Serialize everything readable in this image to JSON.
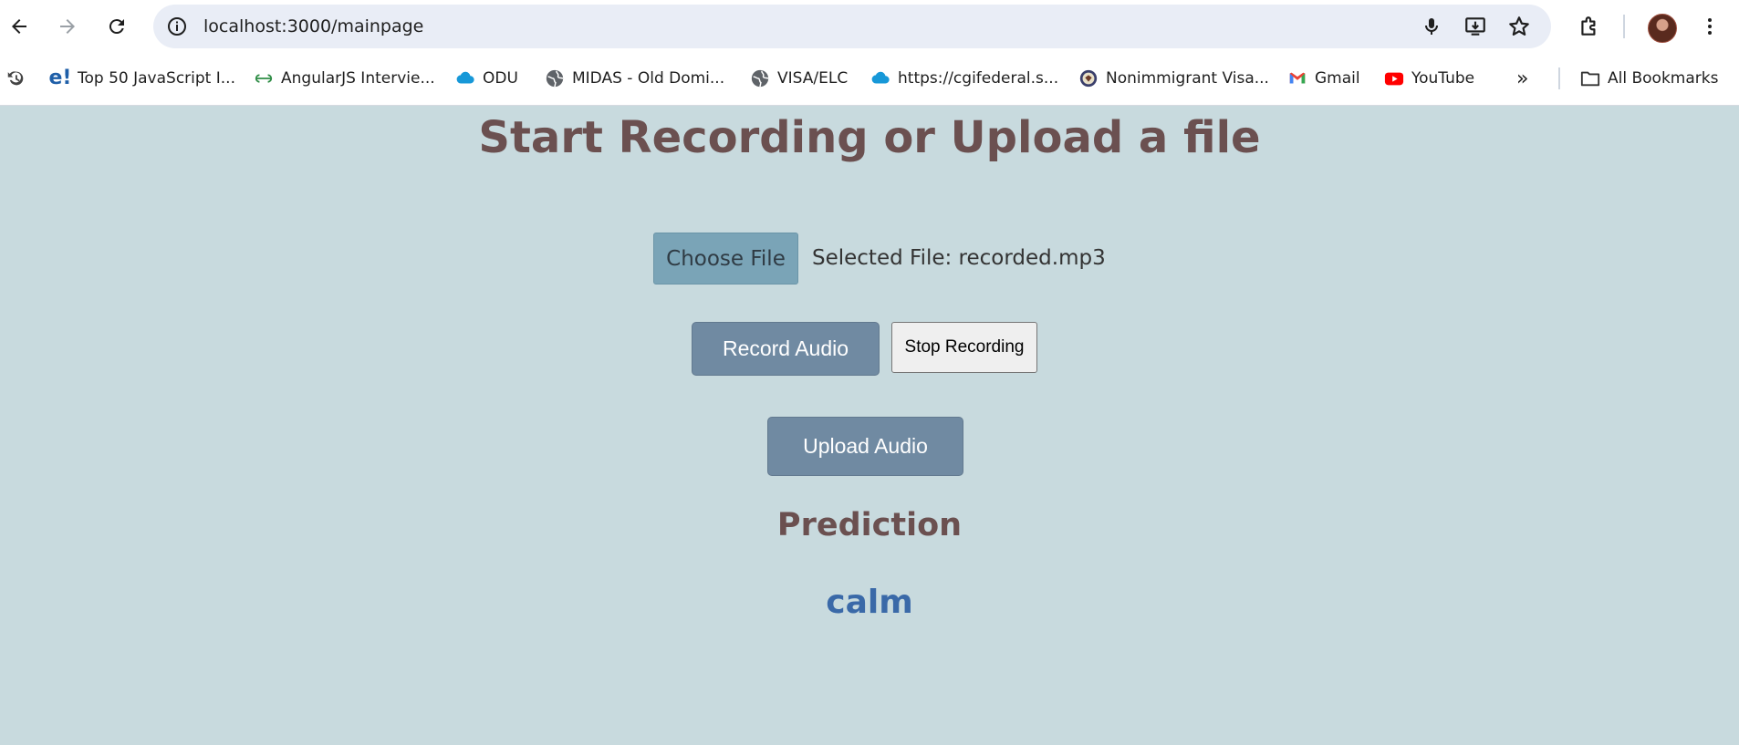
{
  "browser": {
    "url": "localhost:3000/mainpage",
    "bookmarks": [
      {
        "label": "Top 50 JavaScript I...",
        "icon": "e-logo-icon"
      },
      {
        "label": "AngularJS Intervie...",
        "icon": "geeks-icon"
      },
      {
        "label": "ODU",
        "icon": "cloud-icon"
      },
      {
        "label": "MIDAS - Old Domi...",
        "icon": "globe-icon"
      },
      {
        "label": "VISA/ELC",
        "icon": "globe-icon"
      },
      {
        "label": "https://cgifederal.s...",
        "icon": "cloud-icon"
      },
      {
        "label": "Nonimmigrant Visa...",
        "icon": "seal-icon"
      },
      {
        "label": "Gmail",
        "icon": "gmail-icon"
      },
      {
        "label": "YouTube",
        "icon": "youtube-icon"
      }
    ],
    "more_bookmarks": "»",
    "all_bookmarks_label": "All Bookmarks"
  },
  "page": {
    "title": "Start Recording or Upload a file",
    "choose_file_label": "Choose File",
    "selected_file_text": "Selected File: recorded.mp3",
    "record_label": "Record Audio",
    "stop_label": "Stop Recording",
    "upload_label": "Upload Audio",
    "prediction_heading": "Prediction",
    "prediction_value": "calm"
  },
  "colors": {
    "page_background": "#c8dade",
    "heading": "#6b5050",
    "prediction_value": "#3a69a8",
    "primary_button": "#708aa2",
    "file_button": "#7aa4b7"
  }
}
